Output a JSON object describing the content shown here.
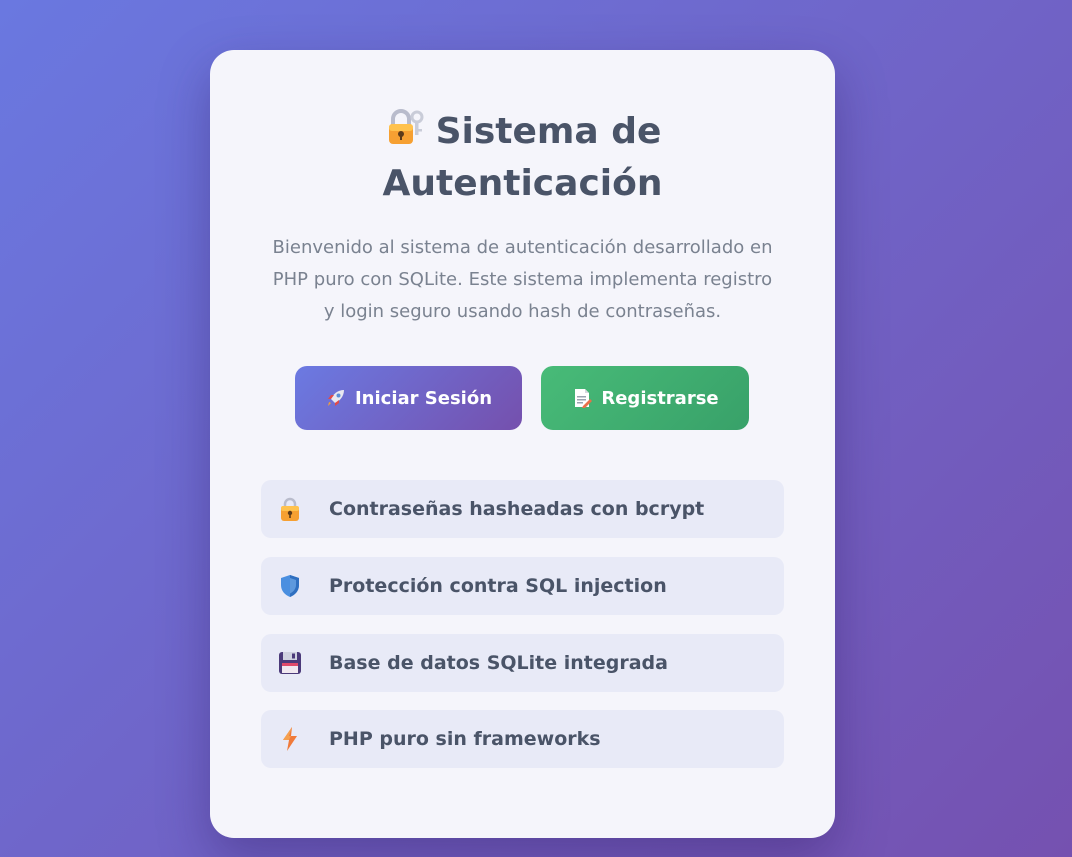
{
  "header": {
    "title": "Sistema de Autenticación",
    "title_icon": "lock-with-key-icon"
  },
  "intro": {
    "description": "Bienvenido al sistema de autenticación desarrollado en PHP puro con SQLite. Este sistema implementa registro y login seguro usando hash de contraseñas."
  },
  "actions": {
    "login_label": "Iniciar Sesión",
    "login_icon": "rocket-icon",
    "register_label": "Registrarse",
    "register_icon": "memo-icon"
  },
  "features": [
    {
      "label": "Contraseñas hasheadas con bcrypt",
      "icon": "lock-icon"
    },
    {
      "label": "Protección contra SQL injection",
      "icon": "shield-icon"
    },
    {
      "label": "Base de datos SQLite integrada",
      "icon": "floppy-disk-icon"
    },
    {
      "label": "PHP puro sin frameworks",
      "icon": "lightning-icon"
    }
  ],
  "colors": {
    "background_start": "#6a78e0",
    "background_end": "#7551b0",
    "card": "#f5f5fb",
    "login_button": "#7064c8",
    "register_button": "#48bb78",
    "feature_row": "#e8eaf7",
    "title_text": "#4a5468",
    "body_text": "#7a8290"
  }
}
